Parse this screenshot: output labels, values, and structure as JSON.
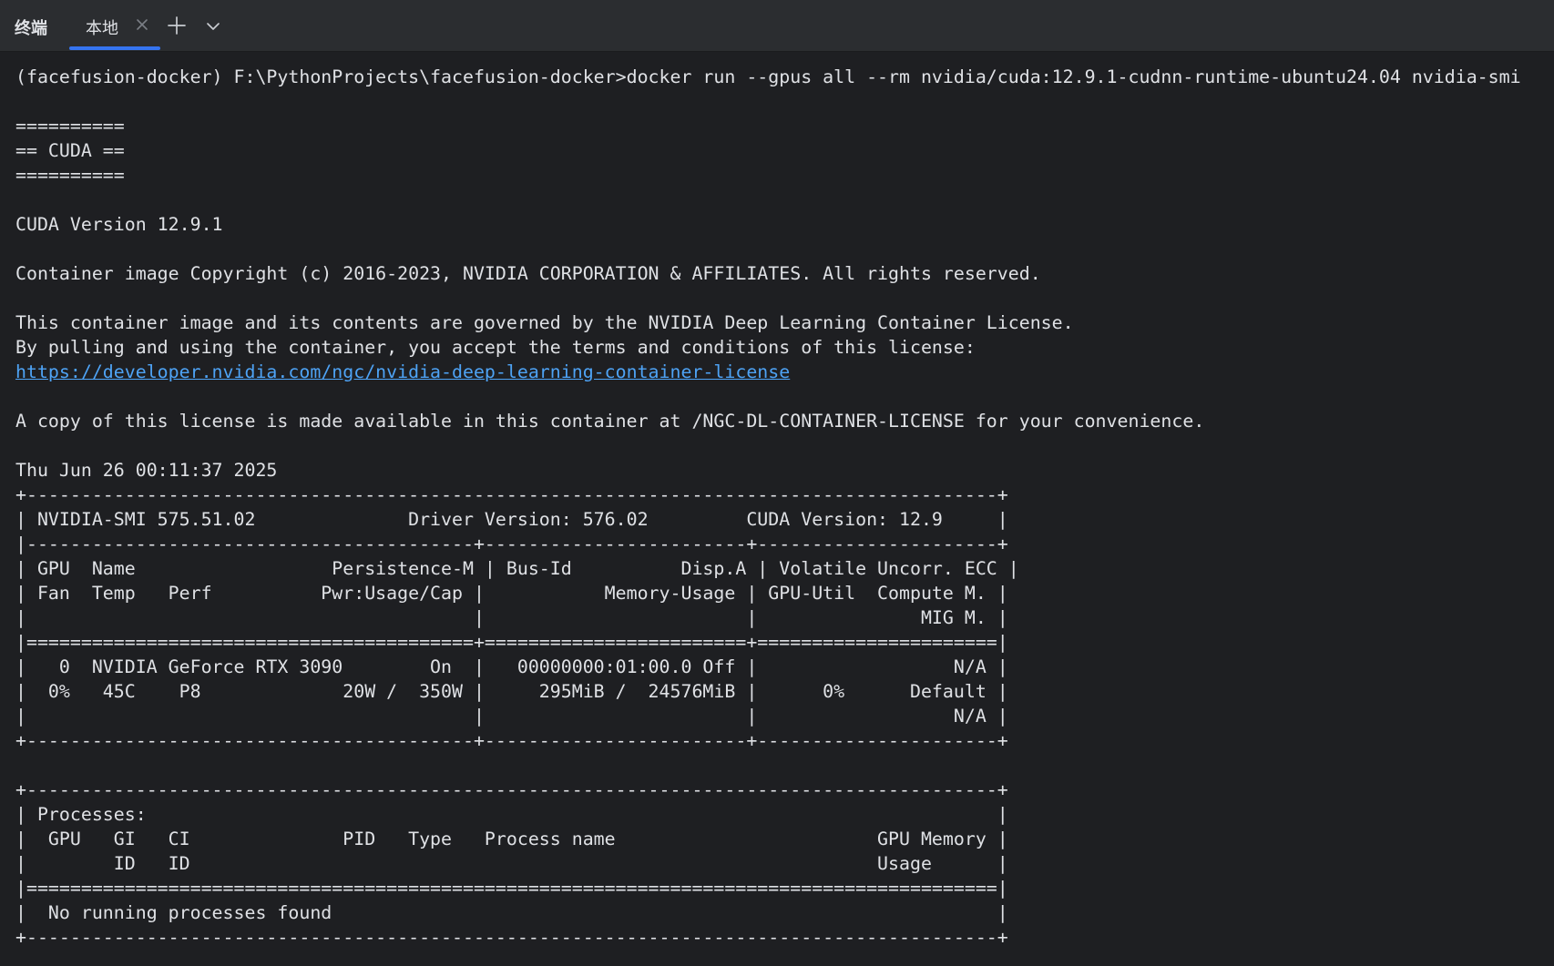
{
  "titlebar": {
    "panel_title": "终端",
    "tab_label": "本地"
  },
  "colors": {
    "background": "#1e1f22",
    "titlebar": "#2b2d30",
    "text": "#dfe1e5",
    "link": "#4ea3f5",
    "tab_accent": "#3574f0"
  },
  "icons": {
    "close": "close-icon",
    "new_tab": "plus-icon",
    "dropdown": "chevron-down-icon"
  },
  "terminal": {
    "lines": [
      "(facefusion-docker) F:\\PythonProjects\\facefusion-docker>docker run --gpus all --rm nvidia/cuda:12.9.1-cudnn-runtime-ubuntu24.04 nvidia-smi",
      "",
      "==========",
      "== CUDA ==",
      "==========",
      "",
      "CUDA Version 12.9.1",
      "",
      "Container image Copyright (c) 2016-2023, NVIDIA CORPORATION & AFFILIATES. All rights reserved.",
      "",
      "This container image and its contents are governed by the NVIDIA Deep Learning Container License.",
      "By pulling and using the container, you accept the terms and conditions of this license:",
      "https://developer.nvidia.com/ngc/nvidia-deep-learning-container-license",
      "",
      "A copy of this license is made available in this container at /NGC-DL-CONTAINER-LICENSE for your convenience.",
      "",
      "Thu Jun 26 00:11:37 2025",
      "+-----------------------------------------------------------------------------------------+",
      "| NVIDIA-SMI 575.51.02              Driver Version: 576.02         CUDA Version: 12.9     |",
      "|-----------------------------------------+------------------------+----------------------+",
      "| GPU  Name                  Persistence-M | Bus-Id          Disp.A | Volatile Uncorr. ECC |",
      "| Fan  Temp   Perf          Pwr:Usage/Cap |           Memory-Usage | GPU-Util  Compute M. |",
      "|                                         |                        |               MIG M. |",
      "|=========================================+========================+======================|",
      "|   0  NVIDIA GeForce RTX 3090        On  |   00000000:01:00.0 Off |                  N/A |",
      "|  0%   45C    P8             20W /  350W |     295MiB /  24576MiB |      0%      Default |",
      "|                                         |                        |                  N/A |",
      "+-----------------------------------------+------------------------+----------------------+",
      "",
      "+-----------------------------------------------------------------------------------------+",
      "| Processes:                                                                              |",
      "|  GPU   GI   CI              PID   Type   Process name                        GPU Memory |",
      "|        ID   ID                                                               Usage      |",
      "|=========================================================================================|",
      "|  No running processes found                                                             |",
      "+-----------------------------------------------------------------------------------------+"
    ]
  }
}
